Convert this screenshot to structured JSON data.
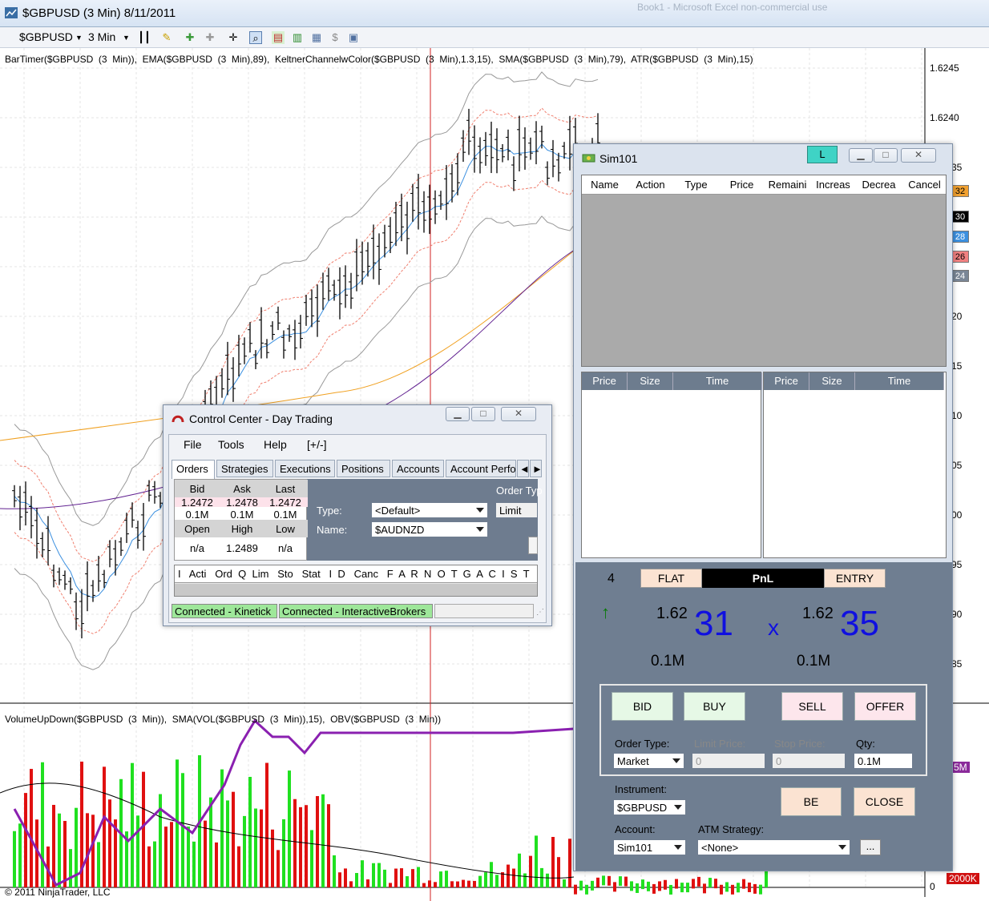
{
  "window": {
    "title": "$GBPUSD (3 Min)  8/11/2011",
    "bg_title": "Book1 - Microsoft Excel non-commercial use"
  },
  "toolbar": {
    "instrument": "$GBPUSD",
    "interval": "3 Min"
  },
  "indicators": {
    "price_panel": "BarTimer($GBPUSD  (3  Min)),  EMA($GBPUSD  (3  Min),89),  KeltnerChannelwColor($GBPUSD  (3  Min),1.3,15),  SMA($GBPUSD  (3  Min),79),  ATR($GBPUSD  (3  Min),15)",
    "volume_panel": "VolumeUpDown($GBPUSD  (3  Min)),  SMA(VOL($GBPUSD  (3  Min)),15),  OBV($GBPUSD  (3  Min))"
  },
  "axis": {
    "p1": "1.6245",
    "p2": "1.6240",
    "p3": "35",
    "p4": "20",
    "p5": "15",
    "p6": "10",
    "p7": "05",
    "p8": "00",
    "p9": "95",
    "p10": "90",
    "p11": "85",
    "vol_top": "5M",
    "vol_bottom": "2000K",
    "vol_zero": "0"
  },
  "tags": [
    {
      "text": "32",
      "color": "#f0a030"
    },
    {
      "text": "30",
      "color": "#000000"
    },
    {
      "text": "28",
      "color": "#3c90e0"
    },
    {
      "text": "26",
      "color": "#f08080"
    },
    {
      "text": "24",
      "color": "#7a8696"
    }
  ],
  "copyright": "© 2011 NinjaTrader, LLC",
  "control_center": {
    "title": "Control Center - Day Trading",
    "menu": [
      "File",
      "Tools",
      "Help",
      "[+/-]"
    ],
    "tabs": [
      "Orders",
      "Strategies",
      "Executions",
      "Positions",
      "Accounts",
      "Account Perfo"
    ],
    "quote": {
      "bid_h": "Bid",
      "ask_h": "Ask",
      "last_h": "Last",
      "bid": "1.2472",
      "ask": "1.2478",
      "last": "1.2472",
      "bid_sz": "0.1M",
      "ask_sz": "0.1M",
      "last_sz": "0.1M",
      "open_h": "Open",
      "high_h": "High",
      "low_h": "Low",
      "open": "n/a",
      "high": "1.2489",
      "low": "n/a"
    },
    "type_label": "Type:",
    "type_value": "<Default>",
    "name_label": "Name:",
    "name_value": "$AUDNZD",
    "order_type_label": "Order Typ",
    "order_type_value": "Limit",
    "columns": "I   Acti   Ord  Q  Lim   Sto   Stat   I  D   Canc   F  A  R  N  O  T  G  A  C  I  S  T   Ti",
    "status1": "Connected - Kinetick",
    "status2": "Connected - InteractiveBrokers"
  },
  "sim": {
    "title": "Sim101",
    "l_btn": "L",
    "order_cols": [
      "Name",
      "Action",
      "Type",
      "Price",
      "Remaini",
      "Increas",
      "Decrea",
      "Cancel"
    ],
    "book_cols": [
      "Price",
      "Size",
      "Time"
    ],
    "pos_qty": "4",
    "flat": "FLAT",
    "pnl": "PnL",
    "entry": "ENTRY",
    "bid_prefix": "1.62",
    "bid_big": "31",
    "x": "x",
    "ask_prefix": "1.62",
    "ask_big": "35",
    "bid_size": "0.1M",
    "ask_size": "0.1M",
    "btn_bid": "BID",
    "btn_buy": "BUY",
    "btn_sell": "SELL",
    "btn_offer": "OFFER",
    "order_type_label": "Order Type:",
    "order_type": "Market",
    "limit_label": "Limit Price:",
    "limit": "0",
    "stop_label": "Stop Price:",
    "stop": "0",
    "qty_label": "Qty:",
    "qty": "0.1M",
    "instrument_label": "Instrument:",
    "instrument": "$GBPUSD",
    "be": "BE",
    "close": "CLOSE",
    "account_label": "Account:",
    "account": "Sim101",
    "atm_label": "ATM Strategy:",
    "atm": "<None>",
    "more": "..."
  }
}
